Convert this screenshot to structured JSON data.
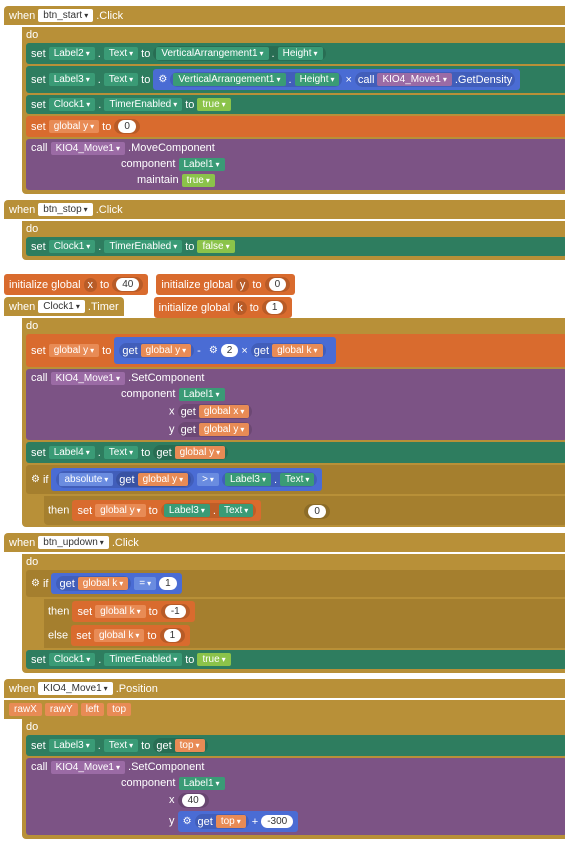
{
  "when": "when",
  "do": "do",
  "set": "set",
  "call": "call",
  "to": "to",
  "get": "get",
  "if": "if",
  "then": "then",
  "else": "else",
  "btn_start": "btn_start",
  "btn_stop": "btn_stop",
  "btn_updown": "btn_updown",
  "click": ".Click",
  "timer": ".Timer",
  "position": ".Position",
  "label1": "Label1",
  "label2": "Label2",
  "label3": "Label3",
  "label4": "Label4",
  "text": "Text",
  "clock1": "Clock1",
  "timerEnabled": "TimerEnabled",
  "true": "true",
  "false": "false",
  "va1": "VerticalArrangement1",
  "height": "Height",
  "kio4": "KIO4_Move1",
  "getDensity": ".GetDensity",
  "moveComponent": ".MoveComponent",
  "setComponent": ".SetComponent",
  "component": "component",
  "maintain": "maintain",
  "globaly": "global y",
  "globalx": "global x",
  "globalk": "global k",
  "initialize": "initialize global",
  "x": "x",
  "y": "y",
  "k": "k",
  "n0": "0",
  "n40": "40",
  "n1": "1",
  "n2": "2",
  "nm1": "-1",
  "n300": "-300",
  "mult": "×",
  "minus": "-",
  "plus": "+",
  "eq": "=",
  "gt": ">",
  "abs": "absolute",
  "rawX": "rawX",
  "rawY": "rawY",
  "left": "left",
  "top": "top"
}
